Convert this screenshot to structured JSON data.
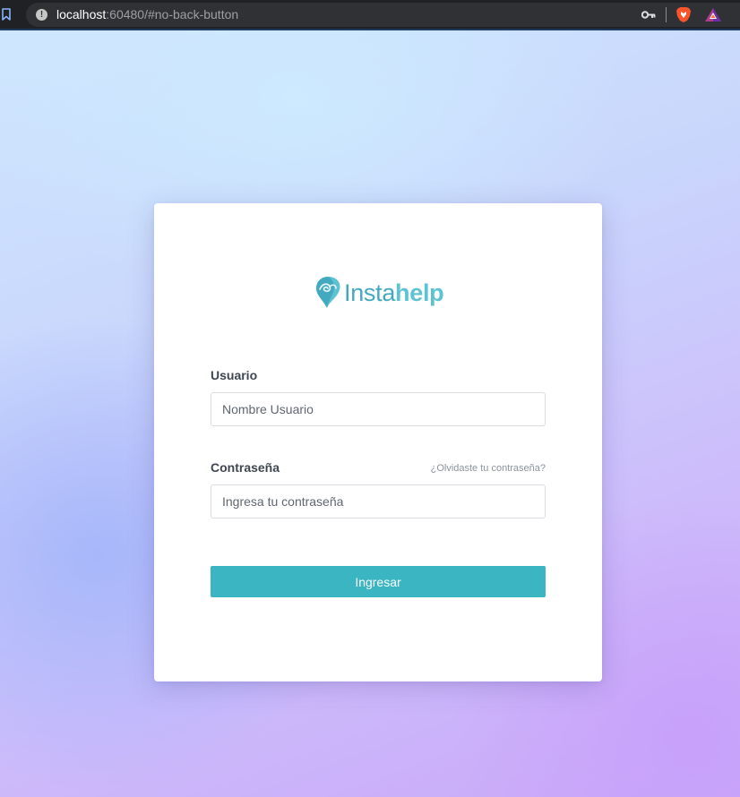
{
  "browser": {
    "url_host": "localhost",
    "url_rest": ":60480/#no-back-button",
    "info_glyph": "!"
  },
  "icons": {
    "bookmark": "bookmark-icon",
    "site_info": "info-icon",
    "password_key": "key-icon",
    "brave": "brave-lion-icon",
    "rewards": "brave-rewards-triangle-icon",
    "logo": "instahelp-leaf-logo-icon"
  },
  "colors": {
    "accent": "#3ab5c1",
    "logo_light": "#5cc3d3",
    "logo_dark": "#43a9bf",
    "label": "#3e4652",
    "browser_bg": "#202124"
  },
  "logo": {
    "part1": "Insta",
    "part2": "help"
  },
  "form": {
    "username_label": "Usuario",
    "username_placeholder": "Nombre Usuario",
    "username_value": "",
    "password_label": "Contraseña",
    "forgot_link": "¿Olvidaste tu contraseña?",
    "password_placeholder": "Ingresa tu contraseña",
    "password_value": "",
    "submit_label": "Ingresar"
  }
}
